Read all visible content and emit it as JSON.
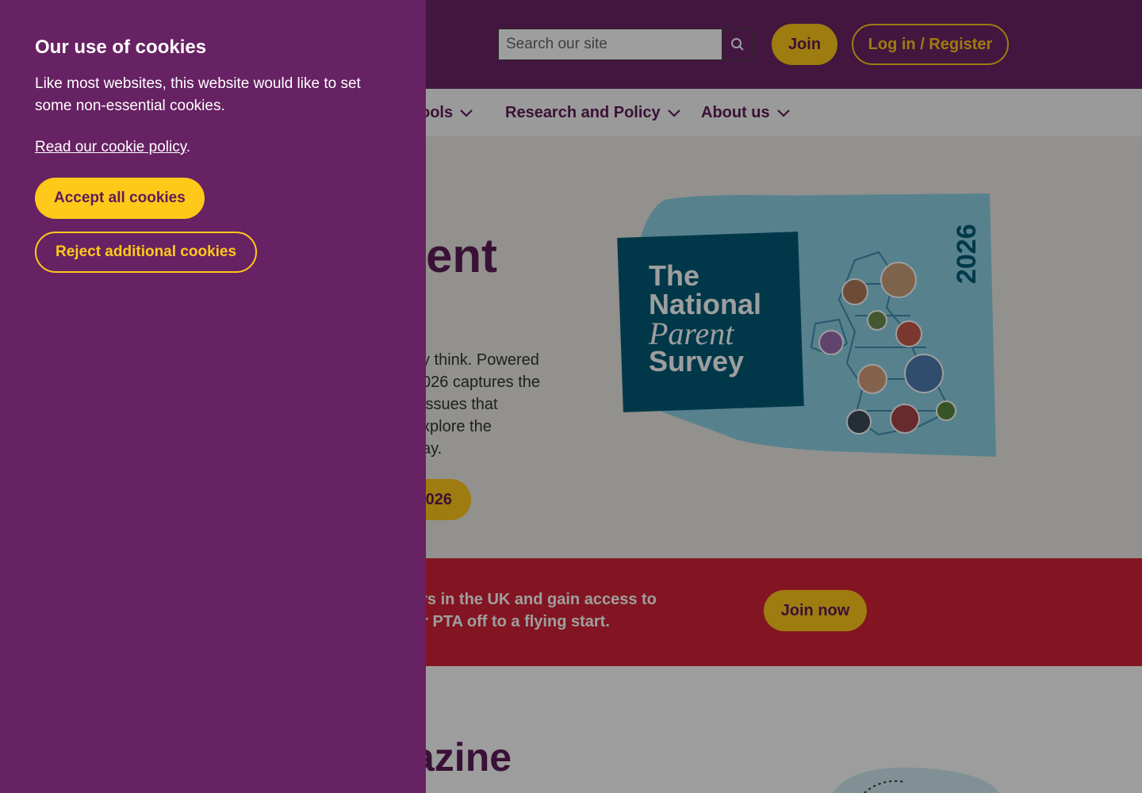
{
  "header": {
    "search_placeholder": "Search our site",
    "join_label": "Join",
    "login_label": "Log in / Register"
  },
  "nav": {
    "items": [
      {
        "label": "ools"
      },
      {
        "label": "Research and Policy"
      },
      {
        "label": "About us"
      }
    ]
  },
  "hero": {
    "title_fragment": "ent",
    "body_fragment": "y think. Powered\n026 captures the\n issues that\nxplore the\nay.",
    "button_fragment": "026",
    "survey_art": {
      "line1": "The",
      "line2": "National",
      "line3": "Parent",
      "line4": "Survey",
      "year": "2026"
    }
  },
  "band": {
    "text_fragment": "ers in the UK and gain access to\nur PTA off to a flying start.",
    "join_now_label": "Join now"
  },
  "lower": {
    "title_fragment": "azine"
  },
  "cookie": {
    "title": "Our use of cookies",
    "text": "Like most websites, this website would like to set some non-essential cookies.",
    "link_text": "Read our cookie policy",
    "link_suffix": ".",
    "accept_label": "Accept all cookies",
    "reject_label": "Reject additional cookies"
  },
  "colors": {
    "brand_purple": "#672263",
    "brand_yellow": "#ffc91a",
    "band_red": "#d42237",
    "survey_teal": "#005b78"
  }
}
